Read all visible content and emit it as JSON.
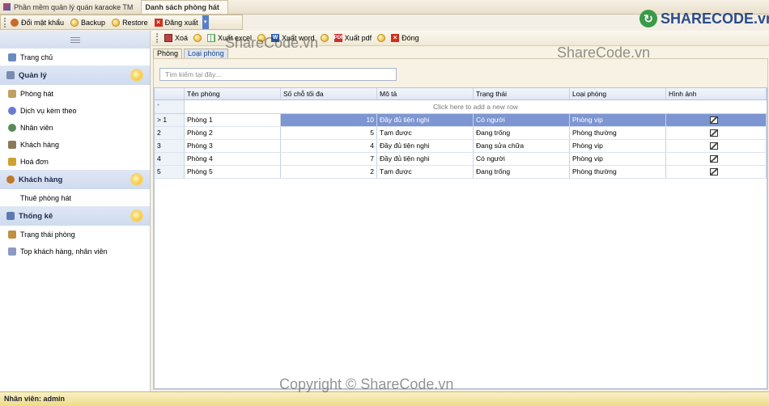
{
  "window_tabs": [
    {
      "label": "Phần mềm quản lý quán karaoke TM",
      "active": false
    },
    {
      "label": "Danh sách phòng hát",
      "active": true
    }
  ],
  "toolbar_main": {
    "items": [
      "Đổi mật khẩu",
      "Backup",
      "Restore",
      "Đăng xuất"
    ]
  },
  "brand": {
    "text": "SHARECODE.vn",
    "watermark": "ShareCode.vn",
    "copyright": "Copyright © ShareCode.vn"
  },
  "sidebar": {
    "top_items": [
      {
        "label": "Trang chủ",
        "icon": "home-icon"
      }
    ],
    "groups": [
      {
        "title": "Quản lý",
        "items": [
          "Phòng hát",
          "Dịch vụ kèm theo",
          "Nhân viên",
          "Khách hàng",
          "Hoá đơn"
        ]
      },
      {
        "title": "Khách hàng",
        "items": [
          "Thuê phòng hát"
        ]
      },
      {
        "title": "Thống kê",
        "items": [
          "Trạng thái phòng",
          "Top khách hàng, nhân viên"
        ]
      }
    ]
  },
  "toolbar_grid": {
    "items": [
      "Xoá",
      "Xuất excel",
      "Xuất word",
      "Xuất pdf",
      "Đóng"
    ]
  },
  "subtabs": [
    {
      "label": "Phòng",
      "active": false
    },
    {
      "label": "Loại phòng",
      "active": true
    }
  ],
  "search": {
    "placeholder": "Tìm kiếm tại đây..."
  },
  "grid": {
    "columns": [
      "Tên phòng",
      "Số chỗ tối đa",
      "Mô tả",
      "Trạng thái",
      "Loại phòng",
      "Hình ảnh"
    ],
    "new_row_text": "Click here to add a new row",
    "rows": [
      {
        "id": "1",
        "name": "Phòng 1",
        "seats": "10",
        "desc": "Đầy đủ tiện nghi",
        "status": "Có người",
        "type": "Phòng vip"
      },
      {
        "id": "2",
        "name": "Phòng 2",
        "seats": "5",
        "desc": "Tạm được",
        "status": "Đang trống",
        "type": "Phòng thường"
      },
      {
        "id": "3",
        "name": "Phòng 3",
        "seats": "4",
        "desc": "Đầy đủ tiện nghi",
        "status": "Đang sửa chữa",
        "type": "Phòng vip"
      },
      {
        "id": "4",
        "name": "Phòng 4",
        "seats": "7",
        "desc": "Đầy đủ tiện nghi",
        "status": "Có người",
        "type": "Phòng vip"
      },
      {
        "id": "5",
        "name": "Phòng 5",
        "seats": "2",
        "desc": "Tạm được",
        "status": "Đang trống",
        "type": "Phòng thường"
      }
    ],
    "selected_row": 0,
    "selected_marker": ">"
  },
  "statusbar": {
    "text": "Nhân viên: admin"
  }
}
